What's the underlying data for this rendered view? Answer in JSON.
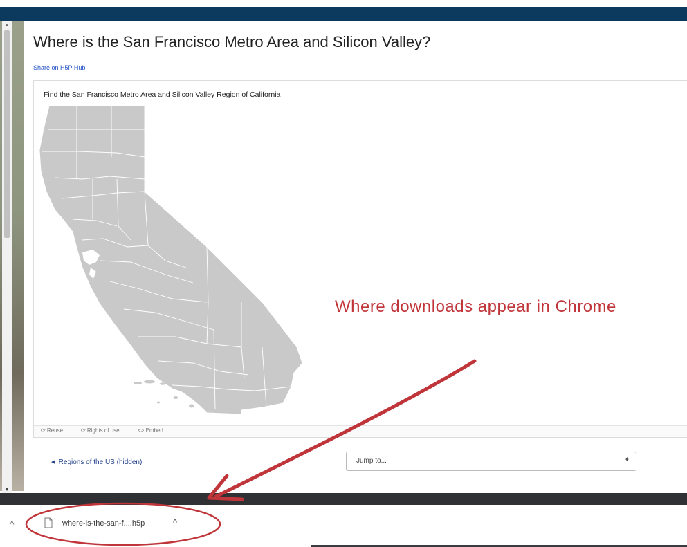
{
  "page": {
    "title": "Where is the San Francisco Metro Area and Silicon Valley?",
    "share_link": "Share on H5P Hub"
  },
  "h5p": {
    "question": "Find the San Francisco Metro Area and Silicon Valley Region of California",
    "footer": {
      "reuse": "⟳ Reuse",
      "rights": "⟳ Rights of use",
      "embed": "<> Embed"
    }
  },
  "navigation": {
    "prev_link": "◄ Regions of the US (hidden)",
    "jump_to": {
      "selected": "Jump to...",
      "caret": "♦"
    }
  },
  "annotation": {
    "text": "Where downloads appear in Chrome",
    "color": "#c0353a"
  },
  "download_shelf": {
    "shelf_caret": "^",
    "item": {
      "file_name": "where-is-the-san-f....h5p",
      "icon": "file-icon",
      "caret": "^"
    }
  },
  "colors": {
    "top_bar": "#0c3a5e",
    "map_fill": "#c9c9c9",
    "link": "#1f4fc4"
  }
}
